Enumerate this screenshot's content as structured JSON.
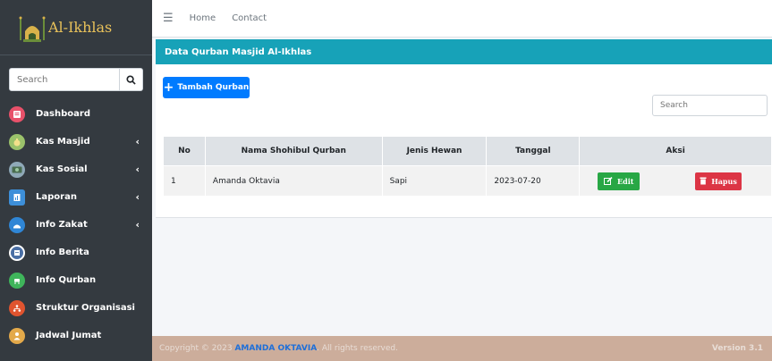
{
  "brand": {
    "name": "Al-Ikhlas"
  },
  "sidebar": {
    "search_placeholder": "Search",
    "items": [
      {
        "label": "Dashboard",
        "icon": "dashboard-icon",
        "color": "#e8516a",
        "has_children": false
      },
      {
        "label": "Kas Masjid",
        "icon": "money-bag-icon",
        "color": "#9bc26b",
        "has_children": true
      },
      {
        "label": "Kas Sosial",
        "icon": "cash-icon",
        "color": "#8fa9b8",
        "has_children": true
      },
      {
        "label": "Laporan",
        "icon": "report-icon",
        "color": "#3d8fd9",
        "has_children": true
      },
      {
        "label": "Info Zakat",
        "icon": "zakat-icon",
        "color": "#2f86d6",
        "has_children": true
      },
      {
        "label": "Info Berita",
        "icon": "news-icon",
        "color": "#4a6fa5",
        "has_children": false
      },
      {
        "label": "Info Qurban",
        "icon": "goat-icon",
        "color": "#3fb55b",
        "has_children": false
      },
      {
        "label": "Struktur Organisasi",
        "icon": "org-chart-icon",
        "color": "#e0542f",
        "has_children": false
      },
      {
        "label": "Jadwal Jumat",
        "icon": "person-icon",
        "color": "#e3a94a",
        "has_children": false
      }
    ]
  },
  "topbar": {
    "links": [
      "Home",
      "Contact"
    ]
  },
  "card": {
    "title": "Data Qurban Masjid Al-Ikhlas",
    "add_button": "Tambah Qurban",
    "search_placeholder": "Search"
  },
  "table": {
    "headers": [
      "No",
      "Nama Shohibul Qurban",
      "Jenis Hewan",
      "Tanggal",
      "Aksi"
    ],
    "rows": [
      {
        "no": "1",
        "nama": "Amanda Oktavia",
        "jenis": "Sapi",
        "tanggal": "2023-07-20",
        "edit_label": "Edit",
        "delete_label": "Hapus"
      }
    ]
  },
  "footer": {
    "prefix": "Copyright © 2023 ",
    "author": "AMANDA OKTAVIA",
    "suffix": ". All rights reserved.",
    "version": "Version 3.1"
  },
  "colors": {
    "sidebar_bg": "#343a40",
    "header_teal": "#17a2b8",
    "primary": "#007bff",
    "success": "#28a745",
    "danger": "#dc3545",
    "footer_bg": "#ccad9b"
  }
}
